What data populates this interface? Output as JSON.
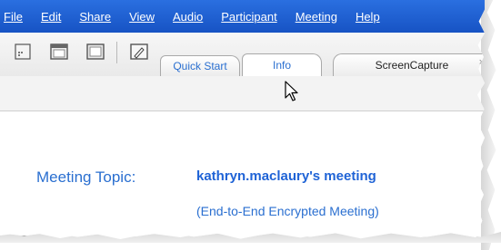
{
  "menubar": {
    "items": [
      "File",
      "Edit",
      "Share",
      "View",
      "Audio",
      "Participant",
      "Meeting",
      "Help"
    ]
  },
  "toolbar": {
    "buttons": [
      "share-icon",
      "window-icon",
      "app-icon",
      "annotate-icon"
    ]
  },
  "tabs": {
    "quick_start": "Quick Start",
    "info": "Info",
    "screen_capture": "ScreenCapture",
    "screen_capture_close": "×"
  },
  "meeting": {
    "topic_label": "Meeting Topic:",
    "topic_value": "kathryn.maclaury's meeting",
    "encryption_note": "(End-to-End Encrypted Meeting)",
    "host_fragment": "kathryn.maclaury"
  },
  "colors": {
    "menubar": "#1e5fd0",
    "accent_text": "#2a6fd0",
    "link_bold": "#1f63d6"
  }
}
